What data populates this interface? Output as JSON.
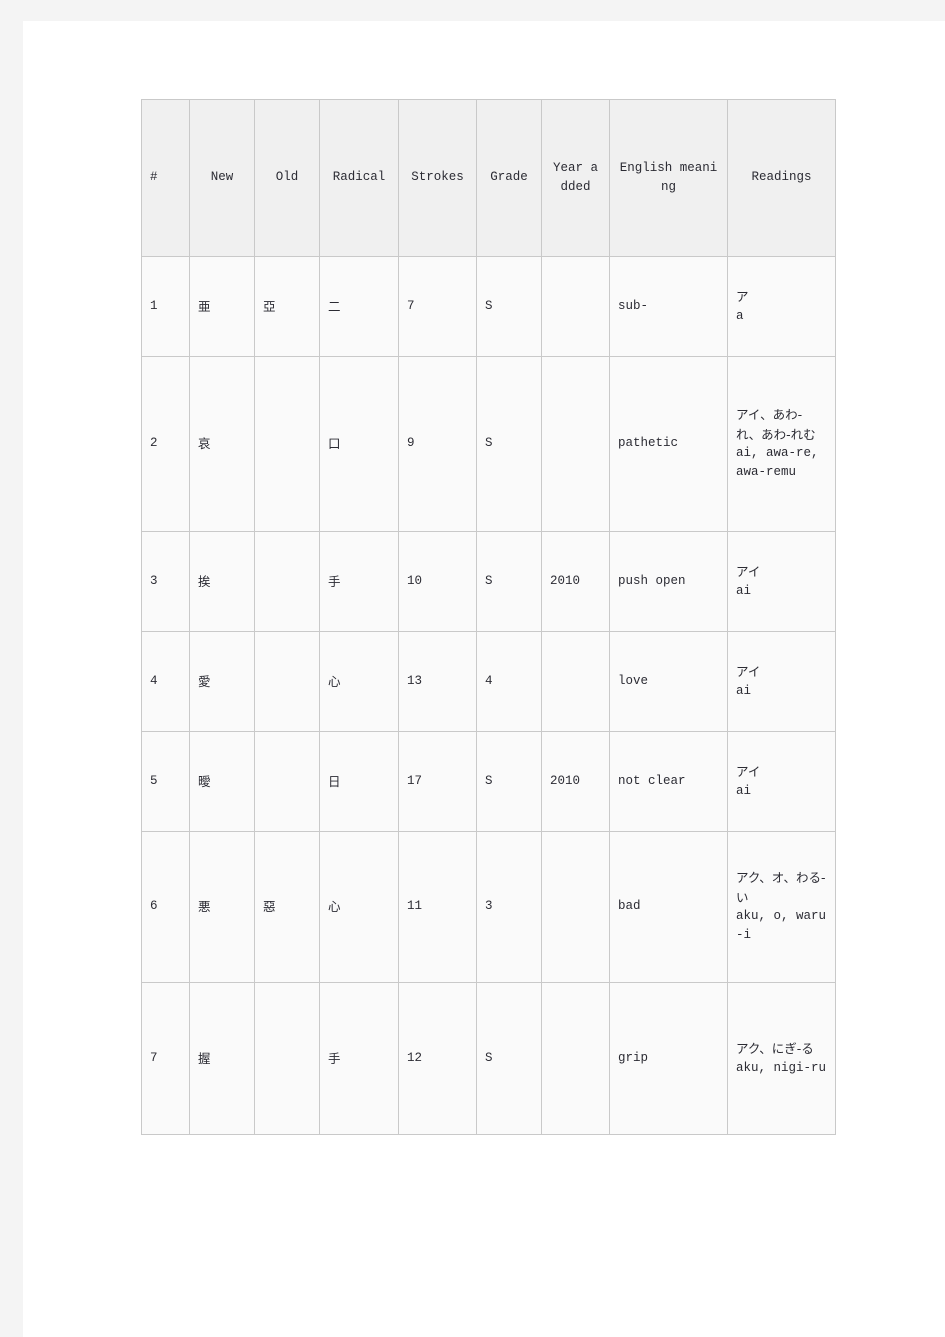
{
  "table": {
    "headers": [
      {
        "label": "#",
        "style": "dark"
      },
      {
        "label": "New",
        "style": "blue"
      },
      {
        "label": "Old",
        "style": "blue"
      },
      {
        "label": "Radical",
        "style": "dark"
      },
      {
        "label": "Strokes",
        "style": "dark"
      },
      {
        "label": "Grade",
        "style": "dark"
      },
      {
        "label": "Year added",
        "style": "dark"
      },
      {
        "label": "English meaning",
        "style": "dark"
      },
      {
        "label": "Readings",
        "style": "dark"
      }
    ],
    "rows": [
      {
        "num": "1",
        "new": "亜",
        "old": "亞",
        "radical": "二",
        "strokes": "7",
        "grade": "S",
        "year_added": "",
        "english": "sub-",
        "reading_kana": "ア",
        "reading_romaji": "a"
      },
      {
        "num": "2",
        "new": "哀",
        "old": "",
        "radical": "口",
        "strokes": "9",
        "grade": "S",
        "year_added": "",
        "english": "pathetic",
        "reading_kana": "アイ、あわ-れ、あわ-れむ",
        "reading_romaji": "ai, awa-re, awa-remu"
      },
      {
        "num": "3",
        "new": "挨",
        "old": "",
        "radical": "手",
        "strokes": "10",
        "grade": "S",
        "year_added": "2010",
        "english": "push open",
        "reading_kana": "アイ",
        "reading_romaji": "ai"
      },
      {
        "num": "4",
        "new": "愛",
        "old": "",
        "radical": "心",
        "strokes": "13",
        "grade": "4",
        "year_added": "",
        "english": "love",
        "reading_kana": "アイ",
        "reading_romaji": "ai"
      },
      {
        "num": "5",
        "new": "曖",
        "old": "",
        "radical": "日",
        "strokes": "17",
        "grade": "S",
        "year_added": "2010",
        "english": "not clear",
        "reading_kana": "アイ",
        "reading_romaji": "ai"
      },
      {
        "num": "6",
        "new": "悪",
        "old": "惡",
        "radical": "心",
        "strokes": "11",
        "grade": "3",
        "year_added": "",
        "english": "bad",
        "reading_kana": "アク、オ、わる-い",
        "reading_romaji": "aku, o, waru-i"
      },
      {
        "num": "7",
        "new": "握",
        "old": "",
        "radical": "手",
        "strokes": "12",
        "grade": "S",
        "year_added": "",
        "english": "grip",
        "reading_kana": "アク、にぎ-る",
        "reading_romaji": "aku, nigi-ru"
      }
    ]
  },
  "colors": {
    "header_bg": "#f0f0f0",
    "row_bg": "#fafafa",
    "border": "#c9c9c9",
    "header_accent": "#2a2a8c",
    "kanji": "#5b5b86",
    "radical": "#4a4a96",
    "page_margin": "#f4f4f4",
    "sheet": "#ffffff"
  }
}
